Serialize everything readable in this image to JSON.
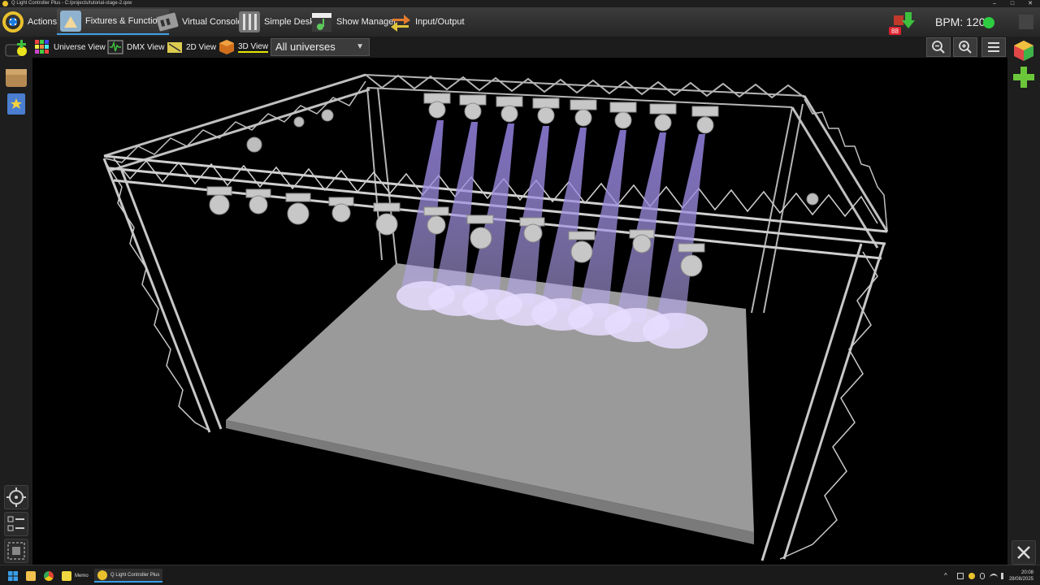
{
  "window": {
    "title": "Q Light Controller Plus - C:/projects/tutorial-stage-2.qxw",
    "controls": [
      "–",
      "□",
      "✕"
    ]
  },
  "toolbar": {
    "tabs": [
      {
        "label": "Actions",
        "icon": "actions-icon"
      },
      {
        "label": "Fixtures & Functions",
        "icon": "fixtures-functions-icon"
      },
      {
        "label": "Virtual Console",
        "icon": "virtual-console-icon"
      },
      {
        "label": "Simple Desk",
        "icon": "simple-desk-icon"
      },
      {
        "label": "Show Manager",
        "icon": "show-manager-icon"
      },
      {
        "label": "Input/Output",
        "icon": "input-output-icon"
      }
    ],
    "active_tab": "Fixtures & Functions",
    "dmx_badge": "88",
    "bpm_label": "BPM: 120",
    "bpm_status_color": "#2ecc40"
  },
  "subtoolbar": {
    "views": [
      {
        "label": "Universe View",
        "icon": "universe-grid-icon"
      },
      {
        "label": "DMX View",
        "icon": "dmx-monitor-icon"
      },
      {
        "label": "2D View",
        "icon": "2d-view-icon"
      },
      {
        "label": "3D View",
        "icon": "3d-cube-icon"
      }
    ],
    "active_view": "3D View",
    "universe_select": "All universes",
    "zoom_out_glyph": "−",
    "zoom_in_glyph": "+",
    "menu_glyph": "≡"
  },
  "taskbar": {
    "items": [
      {
        "label": "Memo"
      },
      {
        "label": "Q Light Controller Plus"
      }
    ],
    "time": "20:08",
    "date": "28/08/2025"
  },
  "colors": {
    "accent_active_tab": "#3fa0e8",
    "active_view_underline": "#e6e600",
    "beam": "#8c7ad6",
    "stage_floor": "#9a9a9a"
  }
}
